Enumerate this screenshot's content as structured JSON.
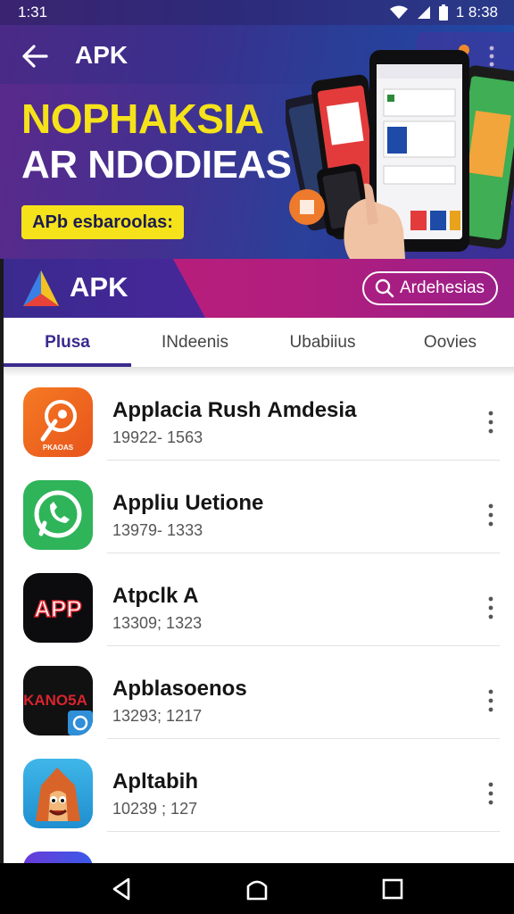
{
  "status_bar": {
    "time": "1:31",
    "right_time": "1 8:38",
    "icons": [
      "wifi-icon",
      "signal-icon",
      "battery-icon"
    ]
  },
  "hero": {
    "title": "APK",
    "headline": "NOPHAKSIA",
    "subline": "AR NDODIEAS",
    "pill_label": "APb esbaroolas:",
    "accent": "#f5e21b"
  },
  "apk_bar": {
    "label": "APK",
    "search_label": "Ardehesias"
  },
  "tabs": [
    {
      "label": "Plusa",
      "active": true
    },
    {
      "label": "INdeenis",
      "active": false
    },
    {
      "label": "Ubabiius",
      "active": false
    },
    {
      "label": "Oovies",
      "active": false
    }
  ],
  "apps": [
    {
      "name": "Applacia Rush Аmdesia",
      "meta": "19922- 1563",
      "icon": "compass-pen-icon",
      "icon_caption": "PKAOAS"
    },
    {
      "name": "Appliu Uetione",
      "meta": "13979- 1333",
      "icon": "phone-chat-icon"
    },
    {
      "name": "Atpclk A",
      "meta": "13309; 1323",
      "icon": "app-text-icon",
      "icon_caption": "APP"
    },
    {
      "name": "Apblasoenos",
      "meta": "13293; 1217",
      "icon": "game-logo-icon",
      "icon_caption": "KANO5A"
    },
    {
      "name": "Apltabih",
      "meta": "10239 ; 127",
      "icon": "cartoon-character-icon"
    }
  ],
  "colors": {
    "brand_purple": "#3a2a8e",
    "brand_magenta": "#c11f7a"
  }
}
